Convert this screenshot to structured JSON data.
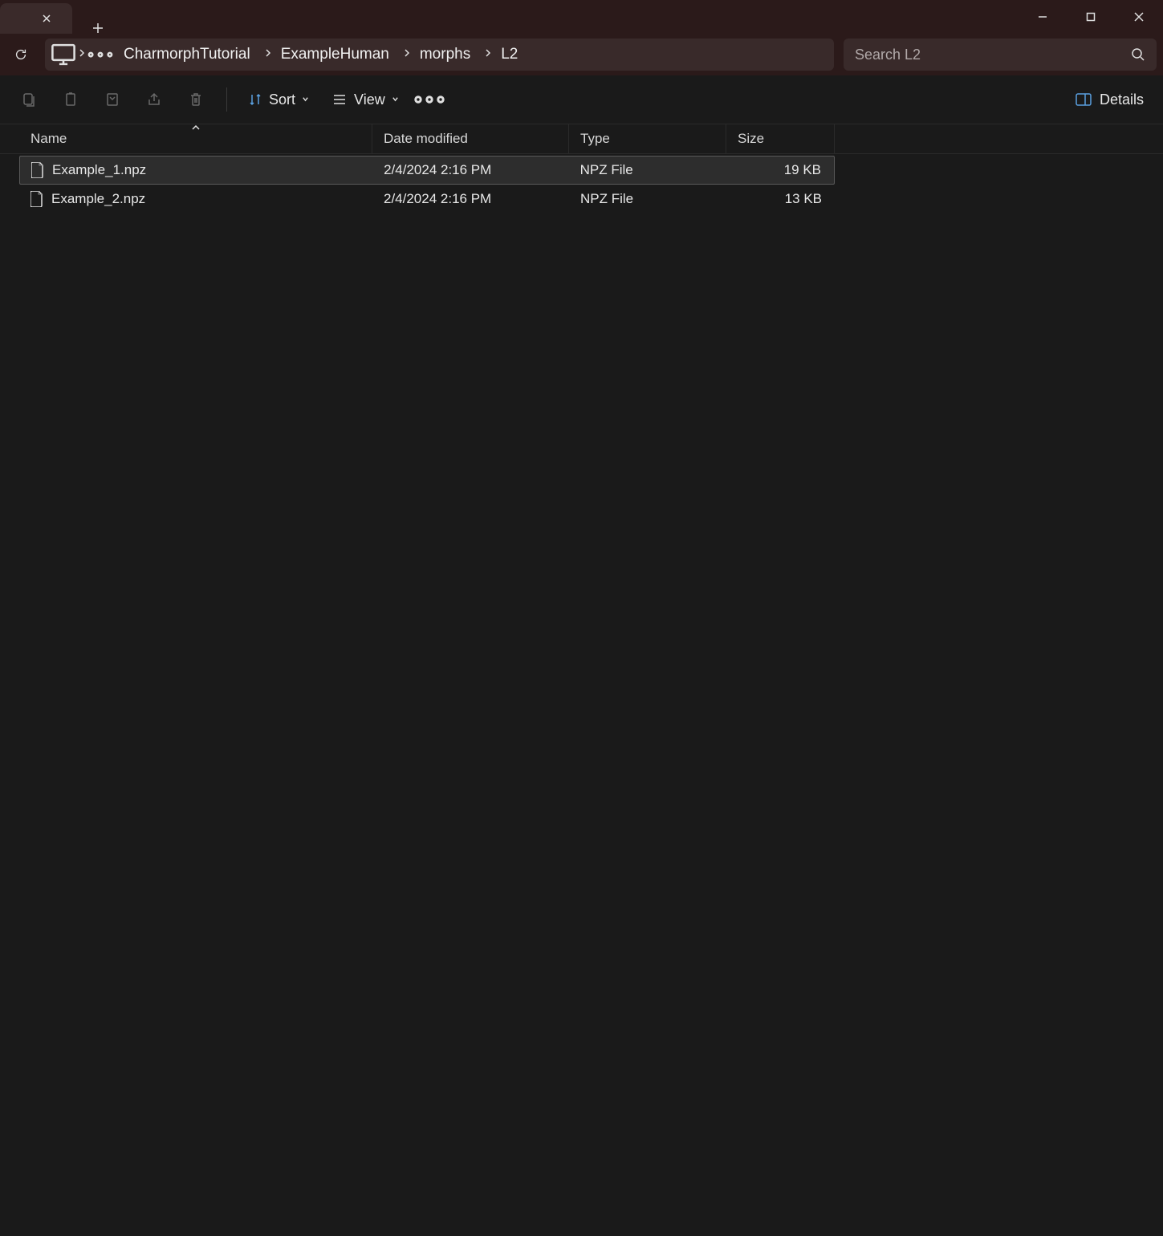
{
  "titlebar": {
    "tab_title": ""
  },
  "breadcrumbs": [
    "CharmorphTutorial",
    "ExampleHuman",
    "morphs",
    "L2"
  ],
  "search": {
    "placeholder": "Search L2"
  },
  "toolbar": {
    "sort_label": "Sort",
    "view_label": "View",
    "details_label": "Details"
  },
  "columns": {
    "name": "Name",
    "date": "Date modified",
    "type": "Type",
    "size": "Size"
  },
  "files": [
    {
      "name": "Example_1.npz",
      "date": "2/4/2024 2:16 PM",
      "type": "NPZ File",
      "size": "19 KB",
      "selected": true
    },
    {
      "name": "Example_2.npz",
      "date": "2/4/2024 2:16 PM",
      "type": "NPZ File",
      "size": "13 KB",
      "selected": false
    }
  ]
}
